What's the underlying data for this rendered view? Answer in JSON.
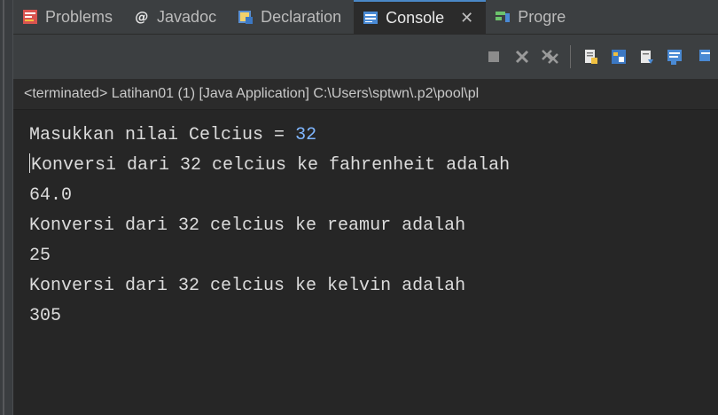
{
  "tabs": [
    {
      "label": "Problems",
      "icon": "problems-icon"
    },
    {
      "label": "Javadoc",
      "icon": "javadoc-icon"
    },
    {
      "label": "Declaration",
      "icon": "declaration-icon"
    },
    {
      "label": "Console",
      "icon": "console-icon",
      "active": true
    },
    {
      "label": "Progre",
      "icon": "progress-icon"
    }
  ],
  "toolbar": {
    "items": [
      "terminate-icon",
      "remove-launch-icon",
      "remove-all-terminated-icon",
      "scroll-lock-icon",
      "word-wrap-icon",
      "show-on-output-icon",
      "pin-console-icon",
      "display-console-icon"
    ]
  },
  "status": {
    "text": "<terminated> Latihan01 (1) [Java Application] C:\\Users\\sptwn\\.p2\\pool\\pl"
  },
  "console": {
    "prompt": "Masukkan nilai Celcius = ",
    "input_value": "32",
    "lines": [
      "Konversi dari 32 celcius ke fahrenheit adalah",
      "64.0",
      "Konversi dari 32 celcius ke reamur adalah",
      "25",
      "Konversi dari 32 celcius ke kelvin adalah",
      "305"
    ]
  },
  "colors": {
    "background": "#262626",
    "input": "#7fb6ff",
    "active_tab_accent": "#4a88c7"
  }
}
